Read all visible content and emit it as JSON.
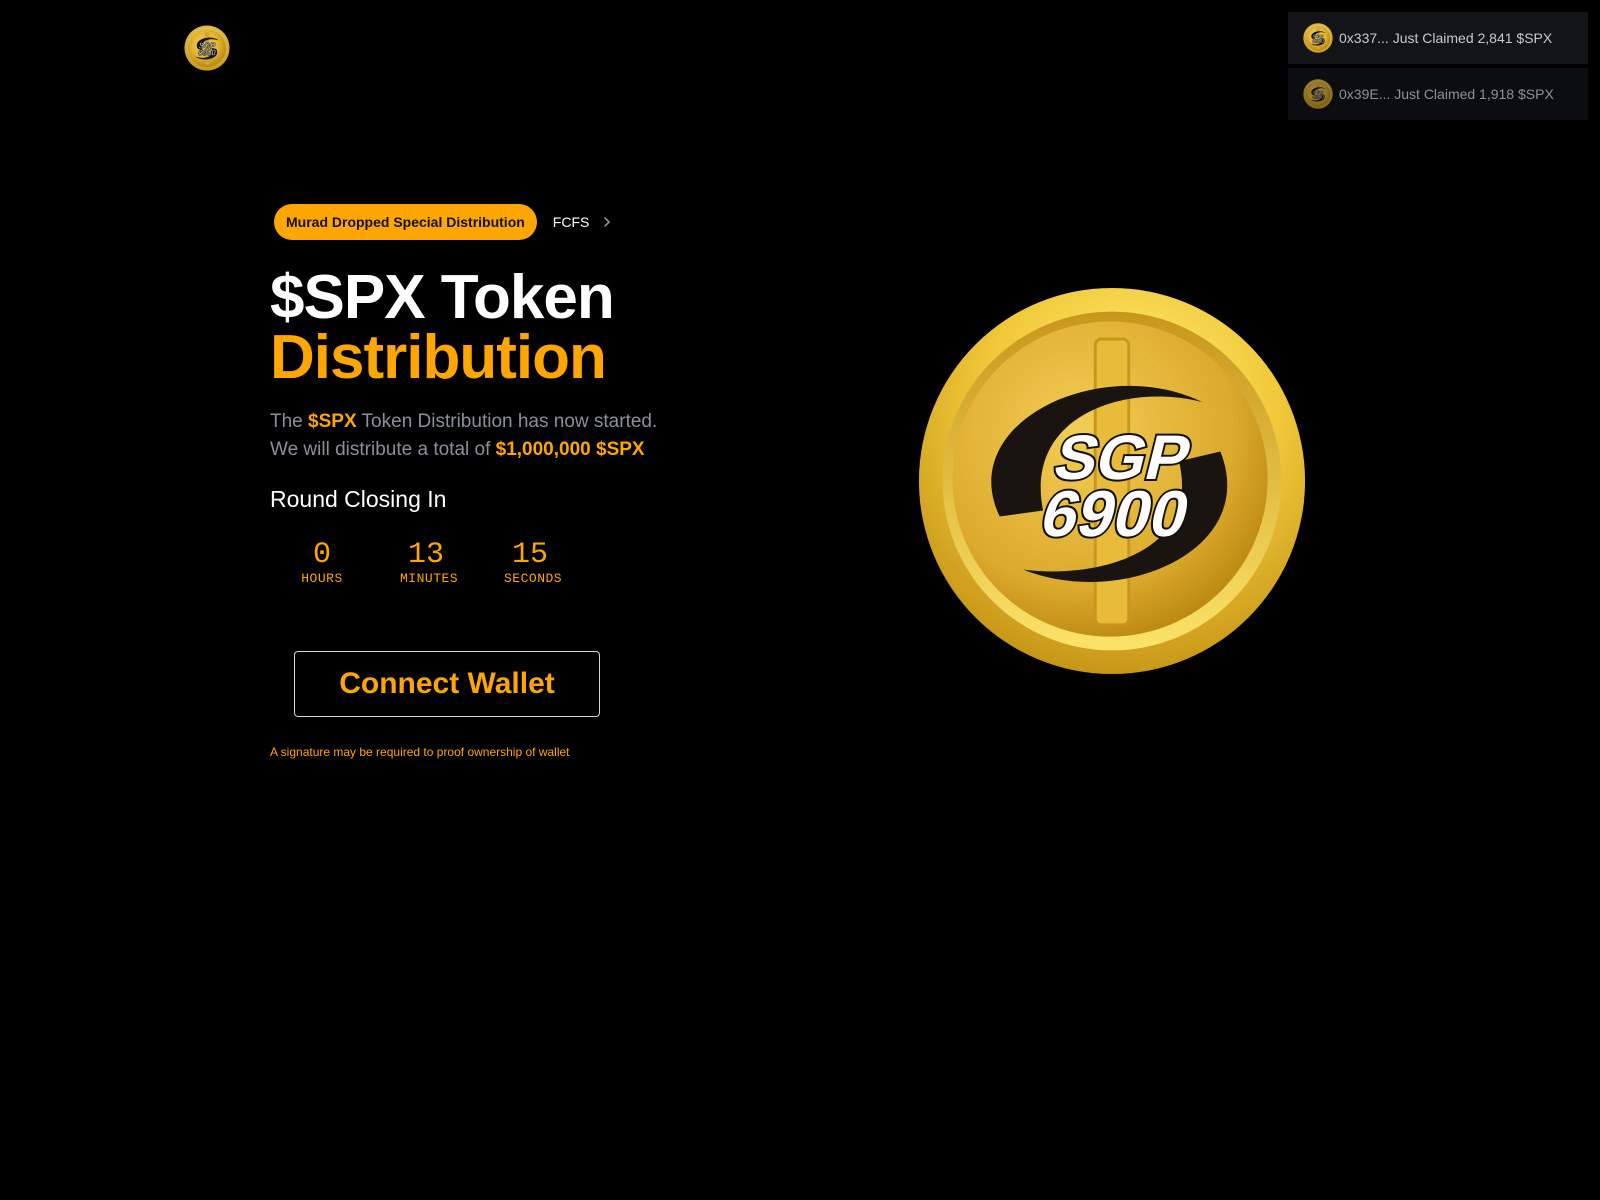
{
  "header": {
    "logo_icon": "spx-coin-logo-icon"
  },
  "notifications": [
    {
      "text": "0x337... Just Claimed 2,841 $SPX",
      "icon": "spx-coin-icon"
    },
    {
      "text": "0x39E... Just Claimed 1,918 $SPX",
      "icon": "spx-coin-icon"
    }
  ],
  "hero": {
    "badge": "Murad Dropped Special Distribution",
    "badge_link": "FCFS",
    "title_line1": "$SPX Token",
    "title_line2": "Distribution",
    "desc1_pre": "The ",
    "desc1_hl": "$SPX",
    "desc1_post": " Token Distribution has now started.",
    "desc2_pre": "We will distribute a total of ",
    "desc2_hl": "$1,000,000 $SPX",
    "round_label": "Round Closing In",
    "countdown": {
      "hours": "0",
      "hours_label": "HOURS",
      "minutes": "13",
      "minutes_label": "MINUTES",
      "seconds": "15",
      "seconds_label": "SECONDS"
    },
    "connect_button": "Connect Wallet",
    "note": "A signature may be required to proof ownership of wallet"
  },
  "coin": {
    "line1": "SGP",
    "line2": "6900"
  },
  "colors": {
    "accent": "#ffa600",
    "background": "#000000",
    "muted_text": "#8a8f9a"
  }
}
